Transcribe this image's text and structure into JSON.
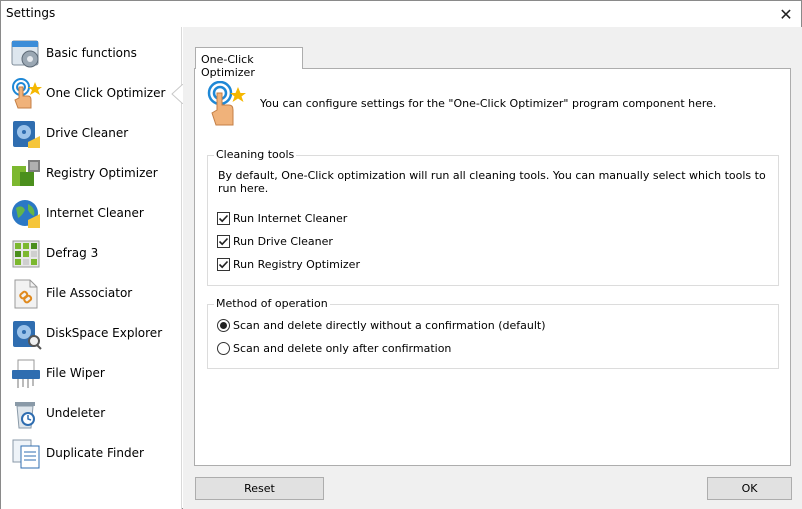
{
  "window": {
    "title": "Settings",
    "close_glyph": "✕"
  },
  "sidebar": {
    "items": [
      {
        "label": "Basic functions",
        "icon": "basic-functions-icon"
      },
      {
        "label": "One Click Optimizer",
        "icon": "one-click-optimizer-icon",
        "selected": true
      },
      {
        "label": "Drive Cleaner",
        "icon": "drive-cleaner-icon"
      },
      {
        "label": "Registry Optimizer",
        "icon": "registry-optimizer-icon"
      },
      {
        "label": "Internet Cleaner",
        "icon": "internet-cleaner-icon"
      },
      {
        "label": "Defrag 3",
        "icon": "defrag-icon"
      },
      {
        "label": "File Associator",
        "icon": "file-associator-icon"
      },
      {
        "label": "DiskSpace Explorer",
        "icon": "diskspace-explorer-icon"
      },
      {
        "label": "File Wiper",
        "icon": "file-wiper-icon"
      },
      {
        "label": "Undeleter",
        "icon": "undeleter-icon"
      },
      {
        "label": "Duplicate Finder",
        "icon": "duplicate-finder-icon"
      }
    ]
  },
  "main": {
    "tab_label": "One-Click Optimizer",
    "intro": "You can configure settings for the \"One-Click Optimizer\" program component here.",
    "cleaning_tools": {
      "title": "Cleaning tools",
      "description": "By default, One-Click optimization will run all cleaning tools. You can manually select which tools to run here.",
      "options": [
        {
          "label": "Run Internet Cleaner",
          "checked": true
        },
        {
          "label": "Run Drive Cleaner",
          "checked": true
        },
        {
          "label": "Run Registry Optimizer",
          "checked": true
        }
      ]
    },
    "method": {
      "title": "Method of operation",
      "options": [
        {
          "label": "Scan and delete directly without a confirmation (default)",
          "selected": true
        },
        {
          "label": "Scan and delete only after confirmation",
          "selected": false
        }
      ]
    }
  },
  "footer": {
    "reset_label": "Reset",
    "ok_label": "OK"
  },
  "colors": {
    "accent_blue": "#1e88d6",
    "hand": "#f0b27a",
    "star": "#f5b700",
    "green": "#7cb82f"
  }
}
